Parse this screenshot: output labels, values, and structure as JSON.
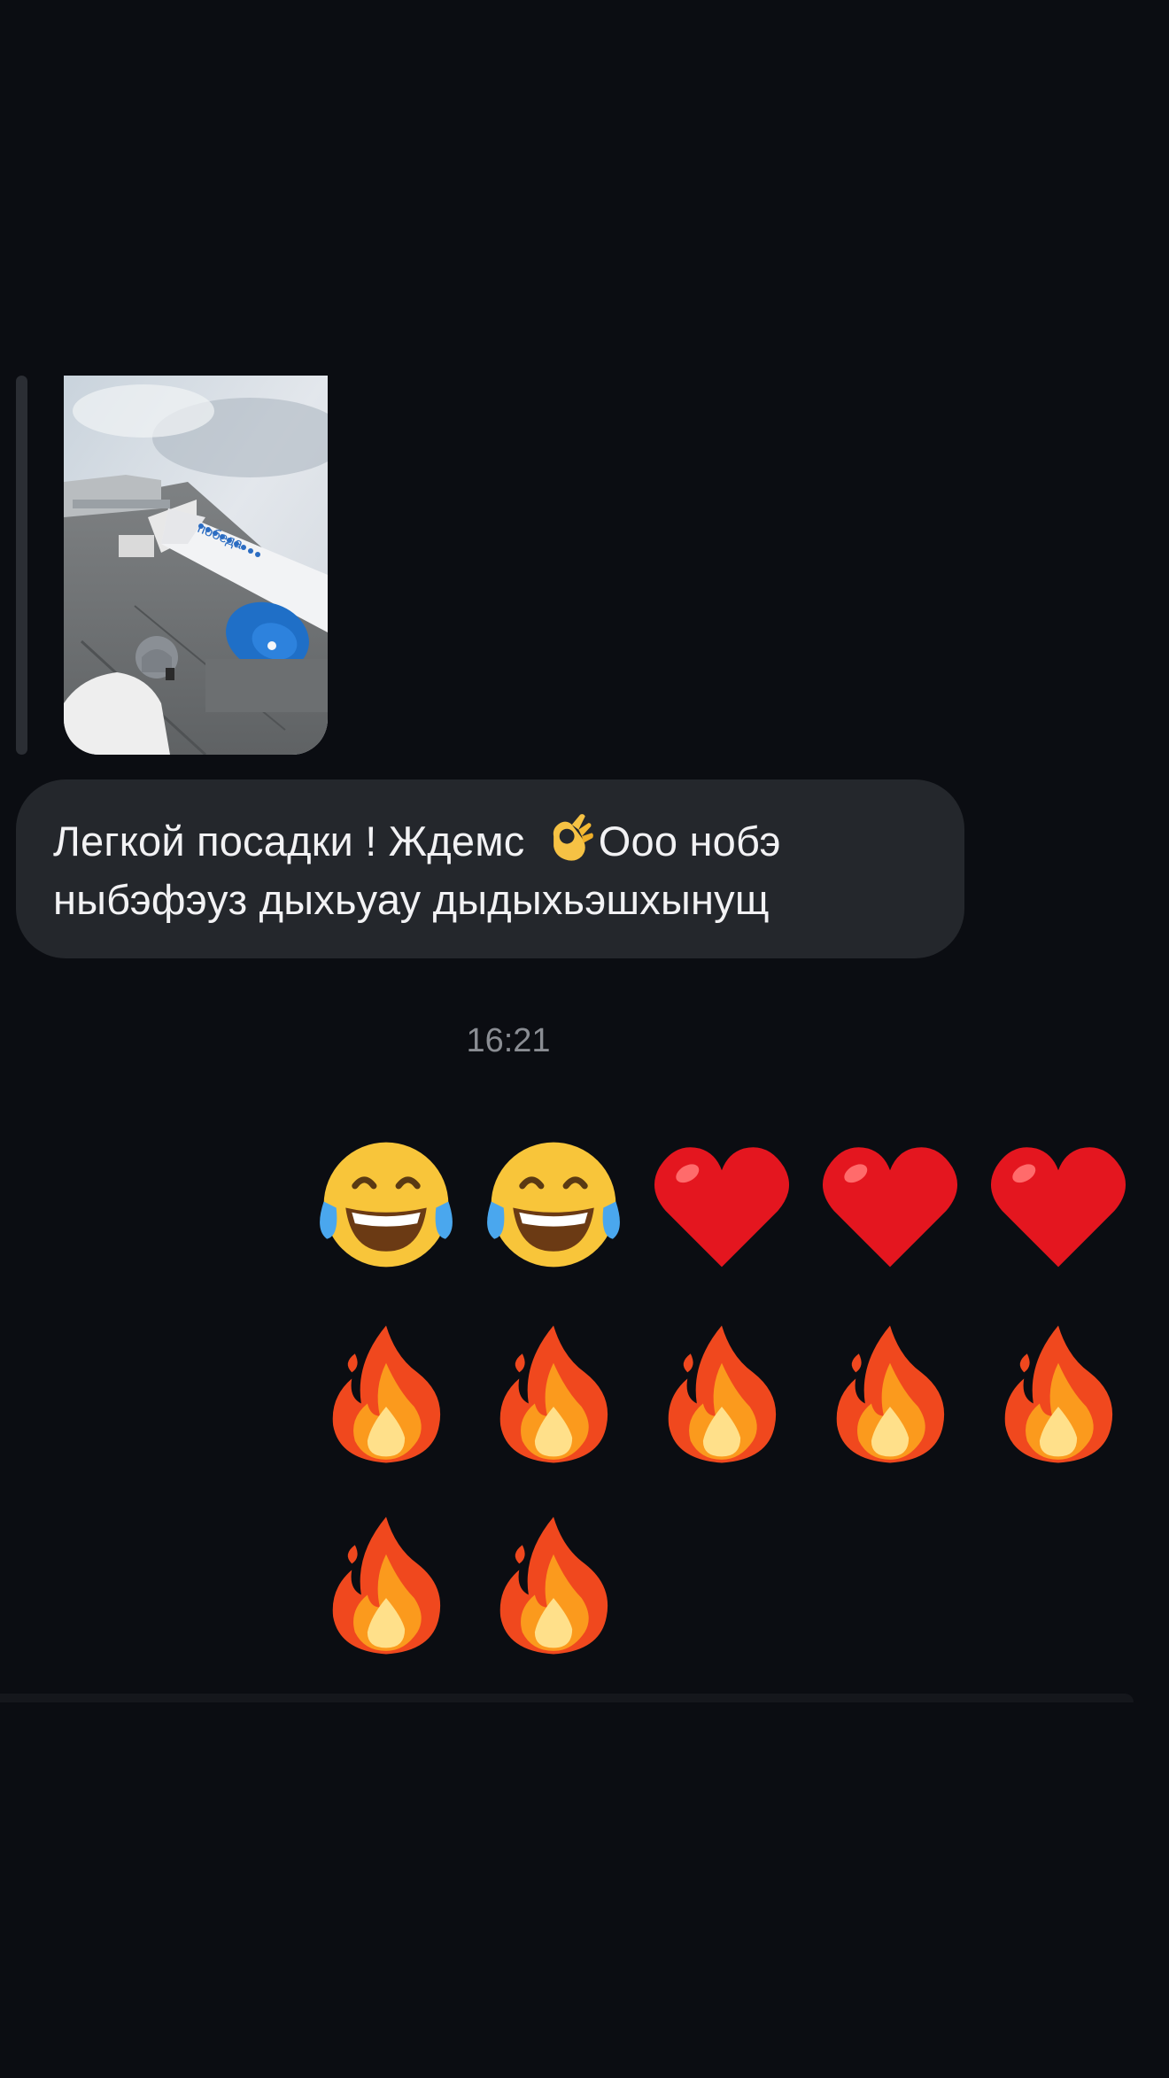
{
  "reply_preview": {
    "image": "airplane-boarding-photo"
  },
  "message": {
    "line1_before_emoji": "Легкой посадки ! Ждемс",
    "inline_emoji": "ok-hand-emoji",
    "line1_after_emoji": "Ооо нобэ",
    "line2": "ныбэфэуз дыхьуау дыдыхьэшхынущ"
  },
  "timestamp": "16:21",
  "emoji_message": {
    "rows": [
      [
        "face-with-tears-of-joy",
        "face-with-tears-of-joy",
        "red-heart",
        "red-heart",
        "red-heart"
      ],
      [
        "fire",
        "fire",
        "fire",
        "fire",
        "fire"
      ],
      [
        "fire",
        "fire"
      ]
    ]
  },
  "colors": {
    "background": "#0b0d12",
    "bubble": "#24272c",
    "text": "#f2f2f4",
    "timestamp": "#8a8d93"
  }
}
